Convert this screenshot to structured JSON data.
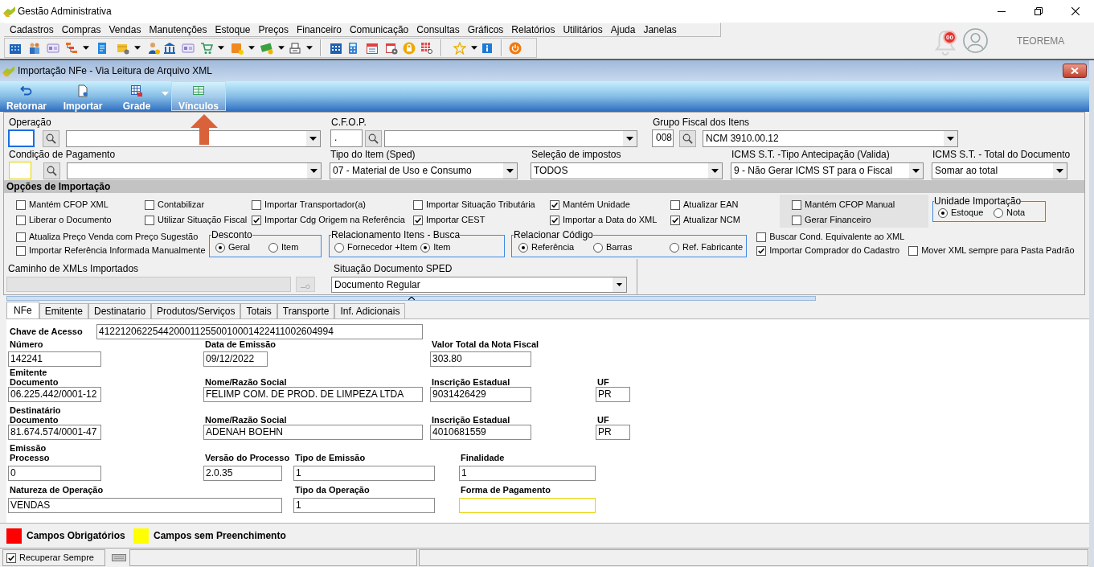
{
  "window": {
    "title": "Gestão Administrativa"
  },
  "menu": [
    "Cadastros",
    "Compras",
    "Vendas",
    "Manutenções",
    "Estoque",
    "Preços",
    "Financeiro",
    "Comunicação",
    "Consultas",
    "Gráficos",
    "Relatórios",
    "Utilitários",
    "Ajuda",
    "Janelas"
  ],
  "notifications": {
    "count": "00"
  },
  "user": {
    "name": "TEOREMA"
  },
  "child_window": {
    "title": "Importação NFe - Via Leitura de Arquivo XML"
  },
  "ribbon": [
    {
      "label": "Retornar",
      "kind": "button",
      "selected": false
    },
    {
      "label": "Importar",
      "kind": "button",
      "selected": false
    },
    {
      "label": "Grade",
      "kind": "split",
      "selected": false
    },
    {
      "label": "Vínculos",
      "kind": "button",
      "selected": true
    }
  ],
  "header_rows": [
    [
      {
        "label": "Operação",
        "kind": "lookup",
        "focused": true,
        "unfilled": false
      },
      {
        "label": "C.F.O.P.",
        "kind": "lookup",
        "code": ".",
        "focused": false,
        "unfilled": false
      },
      {
        "label": "Grupo Fiscal dos Itens",
        "kind": "lookup",
        "code": "008",
        "value": "NCM 3910.00.12",
        "focused": false,
        "unfilled": false
      }
    ],
    [
      {
        "label": "Condição de Pagamento",
        "kind": "lookup",
        "focused": false,
        "unfilled": true
      },
      {
        "label": "Tipo do Item (Sped)",
        "kind": "combo",
        "value": "07 - Material de Uso e Consumo"
      },
      {
        "label": "Seleção de impostos",
        "kind": "combo",
        "value": "TODOS"
      },
      {
        "label": "ICMS S.T. -Tipo Antecipação (Valida)",
        "kind": "combo",
        "value": "9 - Não Gerar ICMS ST para o Fiscal"
      },
      {
        "label": "ICMS S.T. - Total do Documento",
        "kind": "combo",
        "value": "Somar ao total"
      }
    ]
  ],
  "options": {
    "title": "Opções de Importação",
    "upper_columns": [
      [
        {
          "label": "Mantém CFOP XML",
          "checked": false
        },
        {
          "label": "Liberar o Documento",
          "checked": false
        }
      ],
      [
        {
          "label": "Contabilizar",
          "checked": false
        },
        {
          "label": "Utilizar Situação Fiscal",
          "checked": false
        }
      ],
      [
        {
          "label": "Importar Transportador(a)",
          "checked": false
        },
        {
          "label": "Importar Cdg Origem na Referência",
          "checked": true
        }
      ],
      [
        {
          "label": "Importar Situação Tributária",
          "checked": false
        },
        {
          "label": "Importar CEST",
          "checked": true
        }
      ],
      [
        {
          "label": "Mantém Unidade",
          "checked": true
        },
        {
          "label": "Importar a Data do XML",
          "checked": true
        }
      ],
      [
        {
          "label": "Atualizar EAN",
          "checked": false
        },
        {
          "label": "Atualizar NCM",
          "checked": true
        }
      ]
    ],
    "shaded_column": [
      {
        "label": "Mantém CFOP Manual",
        "checked": false
      },
      {
        "label": "Gerar Financeiro",
        "checked": false
      }
    ],
    "unit_group": {
      "title": "Unidade Importação",
      "options": [
        {
          "label": "Estoque",
          "selected": true
        },
        {
          "label": "Nota",
          "selected": false
        }
      ]
    },
    "lower_left": [
      {
        "label": "Atualiza Preço Venda com Preço Sugestão",
        "checked": false
      },
      {
        "label": "Importar Referência Informada Manualmente",
        "checked": false
      }
    ],
    "radio_groups": [
      {
        "title": "Desconto",
        "options": [
          {
            "label": "Geral",
            "selected": true
          },
          {
            "label": "Item",
            "selected": false
          }
        ]
      },
      {
        "title": "Relacionamento Itens - Busca",
        "options": [
          {
            "label": "Fornecedor +Item",
            "selected": false
          },
          {
            "label": "Item",
            "selected": true
          }
        ]
      },
      {
        "title": "Relacionar Código",
        "options": [
          {
            "label": "Referência",
            "selected": true
          },
          {
            "label": "Barras",
            "selected": false
          },
          {
            "label": "Ref. Fabricante",
            "selected": false
          }
        ]
      }
    ],
    "lower_right": [
      {
        "label": "Buscar Cond. Equivalente ao XML",
        "checked": false
      },
      {
        "label": "Importar Comprador do Cadastro",
        "checked": true
      },
      {
        "label": "Mover XML sempre para Pasta Padrão",
        "checked": false
      }
    ]
  },
  "xml_path": {
    "label": "Caminho de XMLs Importados",
    "disabled": true
  },
  "sped_situation": {
    "label": "Situação Documento SPED",
    "value": "Documento Regular"
  },
  "tabs": [
    {
      "label": "NFe",
      "selected": true
    },
    {
      "label": "Emitente",
      "selected": false
    },
    {
      "label": "Destinatario",
      "selected": false
    },
    {
      "label": "Produtos/Serviços",
      "selected": false
    },
    {
      "label": "Totais",
      "selected": false
    },
    {
      "label": "Transporte",
      "selected": false
    },
    {
      "label": "Inf. Adicionais",
      "selected": false
    }
  ],
  "nfe": {
    "access_key": {
      "label": "Chave de Acesso",
      "value": "41221206225442000112550010001422411002604994"
    },
    "rows": [
      {
        "fields": [
          {
            "label": "Número",
            "value": "142241",
            "unfilled": false
          },
          {
            "label": "Data de Emissão",
            "value": "09/12/2022",
            "unfilled": false
          },
          {
            "label": "Valor Total da Nota Fiscal",
            "value": "303.80",
            "unfilled": false
          }
        ]
      },
      {
        "section": "Emitente",
        "fields": [
          {
            "label": "Documento",
            "value": "06.225.442/0001-12",
            "unfilled": false
          },
          {
            "label": "Nome/Razão Social",
            "value": "FELIMP COM. DE PROD. DE LIMPEZA LTDA",
            "unfilled": false
          },
          {
            "label": "Inscrição Estadual",
            "value": "9031426429",
            "unfilled": false
          },
          {
            "label": "UF",
            "value": "PR",
            "unfilled": false
          }
        ]
      },
      {
        "section": "Destinatário",
        "fields": [
          {
            "label": "Documento",
            "value": "81.674.574/0001-47",
            "unfilled": false
          },
          {
            "label": "Nome/Razão Social",
            "value": "ADENAH BOEHN",
            "unfilled": false
          },
          {
            "label": "Inscrição Estadual",
            "value": "4010681559",
            "unfilled": false
          },
          {
            "label": "UF",
            "value": "PR",
            "unfilled": false
          }
        ]
      },
      {
        "section": "Emissão",
        "fields": [
          {
            "label": "Processo",
            "value": "0",
            "unfilled": false
          },
          {
            "label": "Versão do Processo",
            "value": "2.0.35",
            "unfilled": false
          },
          {
            "label": "Tipo de Emissão",
            "value": "1",
            "unfilled": false
          },
          {
            "label": "Finalidade",
            "value": "1",
            "unfilled": false
          }
        ]
      },
      {
        "fields": [
          {
            "label": "Natureza de Operação",
            "value": "VENDAS",
            "unfilled": false
          },
          {
            "label": "Tipo da Operação",
            "value": "1",
            "unfilled": false
          },
          {
            "label": "Forma de Pagamento",
            "unfilled": true
          }
        ]
      }
    ]
  },
  "legend": [
    {
      "label": "Campos Obrigatórios",
      "color": "#ff0000"
    },
    {
      "label": "Campos sem Preenchimento",
      "color": "#ffff00"
    }
  ],
  "status_bar": {
    "recover_always": {
      "label": "Recuperar Sempre",
      "checked": true
    }
  }
}
